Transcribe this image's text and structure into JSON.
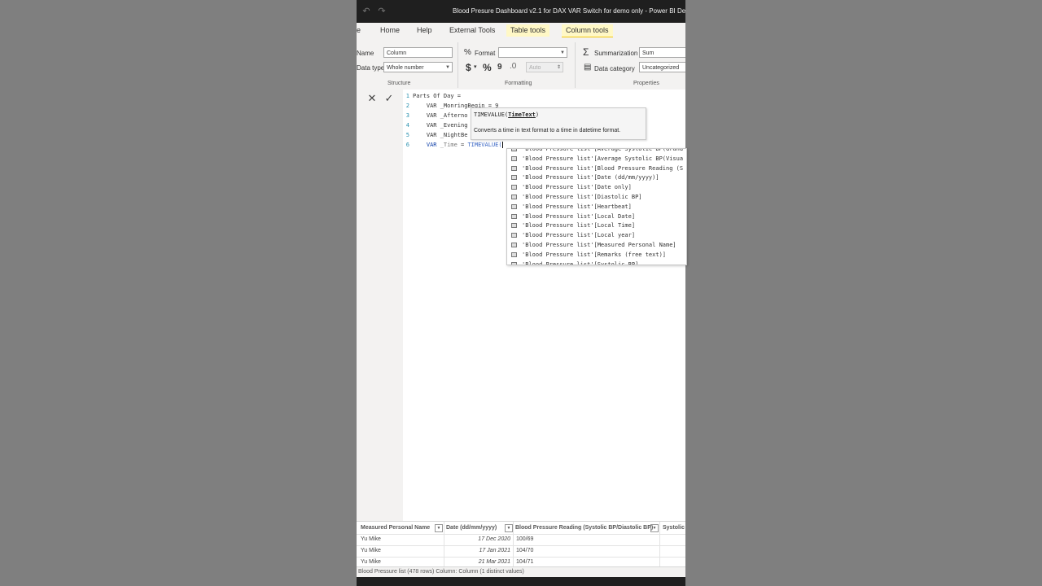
{
  "window": {
    "title": "Blood Presure Dashboard v2.1 for DAX VAR Switch for demo only - Power BI Deskt"
  },
  "tabs": [
    "e",
    "Home",
    "Help",
    "External Tools",
    "Table tools",
    "Column tools"
  ],
  "ribbon": {
    "structure": {
      "name_label": "Name",
      "name_value": "Column",
      "datatype_label": "Data type",
      "datatype_value": "Whole number",
      "group": "Structure"
    },
    "formatting": {
      "format_label": "Format",
      "format_value": "",
      "currency": "$",
      "percent": "%",
      "comma": "9",
      "decimals": "Auto",
      "group": "Formatting"
    },
    "properties": {
      "summarization_label": "Summarization",
      "summarization_value": "Sum",
      "category_label": "Data category",
      "category_value": "Uncategorized",
      "group": "Properties"
    }
  },
  "formula": {
    "lines": [
      {
        "n": "1",
        "text": "Parts Of Day ="
      },
      {
        "n": "2",
        "text": "    VAR _MonringBegin = 9"
      },
      {
        "n": "3",
        "text": "    VAR _Afterno"
      },
      {
        "n": "4",
        "text": "    VAR _Evening"
      },
      {
        "n": "5",
        "text": "    VAR _NightBe"
      },
      {
        "n": "6",
        "kw": "    VAR ",
        "var": "_Time",
        "eq": " = ",
        "fn": "TIMEVALUE("
      }
    ]
  },
  "tooltip": {
    "fn": "TIMEVALUE(",
    "param": "TimeText",
    "close": ")",
    "description": "Converts a time in text format to a time in datetime format."
  },
  "autocomplete": [
    "'Blood Pressure list'[Average Systolic BP(Grand",
    "'Blood Pressure list'[Average Systolic BP(Visua",
    "'Blood Pressure list'[Blood Pressure Reading (S",
    "'Blood Pressure list'[Date (dd/mm/yyyy)]",
    "'Blood Pressure list'[Date only]",
    "'Blood Pressure list'[Diastolic BP]",
    "'Blood Pressure list'[Heartbeat]",
    "'Blood Pressure list'[Local Date]",
    "'Blood Pressure list'[Local Time]",
    "'Blood Pressure list'[Local year]",
    "'Blood Pressure list'[Measured Personal Name]",
    "'Blood Pressure list'[Remarks (free text)]",
    "'Blood Pressure list'[Systolic BP]"
  ],
  "table": {
    "columns": [
      "Measured Personal Name",
      "Date (dd/mm/yyyy)",
      "Blood Pressure Reading (Systolic BP/Diastolic BP)",
      "Systolic B"
    ],
    "rows": [
      [
        "Yu Mike",
        "17 Dec 2020",
        "100/69"
      ],
      [
        "Yu Mike",
        "17 Jan 2021",
        "104/70"
      ],
      [
        "Yu Mike",
        "21 Mar 2021",
        "104/71"
      ]
    ]
  },
  "status": "Blood Pressure list (478 rows) Column: Column (1 distinct values)"
}
